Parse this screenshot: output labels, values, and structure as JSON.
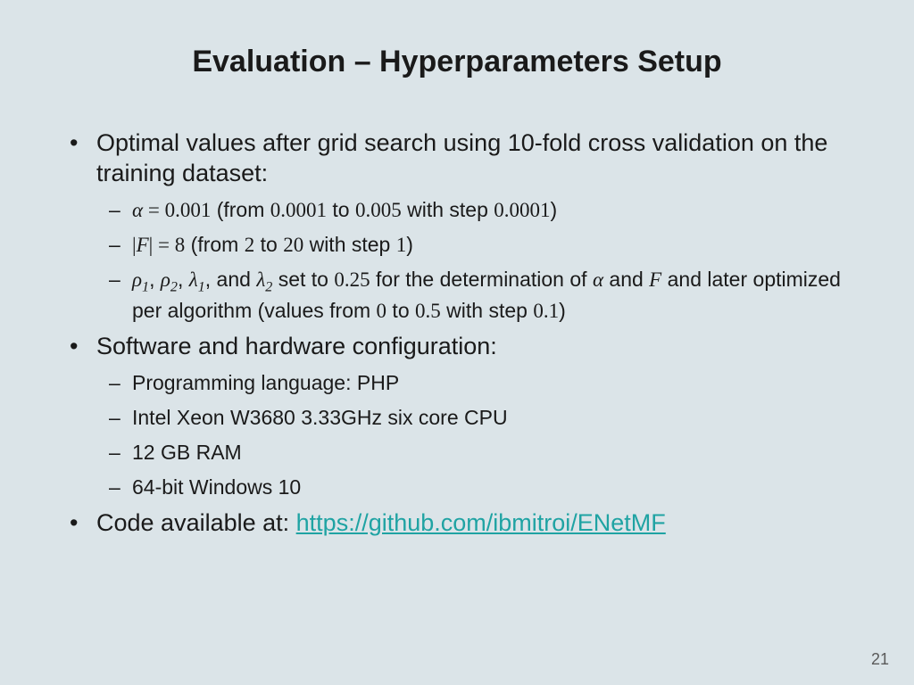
{
  "title": "Evaluation – Hyperparameters Setup",
  "b1": {
    "text": "Optimal values after grid search using 10-fold cross validation on the training dataset:",
    "s1": {
      "alpha": "α",
      "eq": " = ",
      "v": "0.001",
      "from": " (from ",
      "lo": "0.0001",
      "to": " to ",
      "hi": "0.005",
      "ws": " with step ",
      "st": "0.0001",
      "cp": ")"
    },
    "s2": {
      "bar1": "|",
      "F": "F",
      "bar2": "|",
      "eq": " = ",
      "v": "8",
      "from": " (from ",
      "lo": "2",
      "to": " to ",
      "hi": "20",
      "ws": " with step ",
      "st": "1",
      "cp": ")"
    },
    "s3": {
      "r1": "ρ",
      "c1": ", ",
      "r2": "ρ",
      "c2": ", ",
      "l1": "λ",
      "c3": ", and ",
      "l2": "λ",
      "setto": " set to ",
      "v": "0.25",
      "det": " for the determination of ",
      "a": "α",
      "and": " and ",
      "F": "F",
      "tail1": " and later optimized per algorithm (values from ",
      "lo": "0",
      "to": " to ",
      "hi": "0.5",
      "ws": " with step ",
      "st": "0.1",
      "cp": ")"
    }
  },
  "b2": {
    "text": "Software and hardware configuration:",
    "s1": "Programming language: PHP",
    "s2": "Intel Xeon W3680 3.33GHz six core CPU",
    "s3": "12 GB RAM",
    "s4": "64-bit Windows 10"
  },
  "b3": {
    "text": "Code available at: ",
    "url": "https://github.com/ibmitroi/ENetMF"
  },
  "page": "21"
}
